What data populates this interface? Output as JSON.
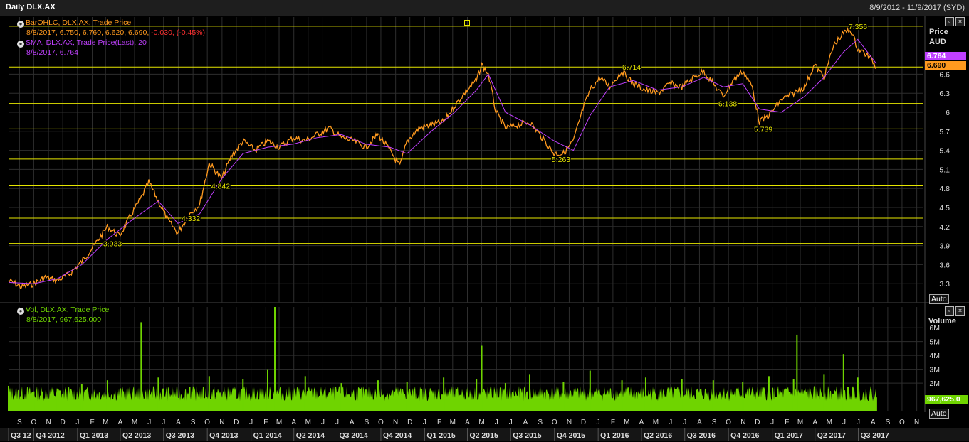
{
  "window": {
    "title": "Daily DLX.AX",
    "date_range": "8/9/2012 - 11/9/2017 (SYD)"
  },
  "price_panel": {
    "legend": {
      "bar_label": "BarOHLC, DLX.AX, Trade Price",
      "bar_values": "8/8/2017, 6.750, 6.760, 6.620, 6.690,",
      "bar_change": "-0.030, (-0.45%)",
      "sma_label": "SMA, DLX.AX, Trade Price(Last),  20",
      "sma_values": "8/8/2017, 6.764"
    },
    "axis_title_1": "Price",
    "axis_title_2": "AUD",
    "auto_label": "Auto",
    "last_sma_tag": "6.764",
    "last_price_tag": "6.690",
    "colors": {
      "price": "#ff9a1f",
      "sma": "#c040ff",
      "level": "#e6e600",
      "grid": "#2e2e2e"
    }
  },
  "volume_panel": {
    "legend": {
      "label": "Vol, DLX.AX, Trade Price",
      "values": "8/8/2017, 967,625.000"
    },
    "axis_title": "Volume",
    "auto_label": "Auto",
    "last_volume_tag": "967,625.0",
    "colors": {
      "volume": "#6fd400"
    }
  },
  "chart_data": [
    {
      "type": "line",
      "series": [
        {
          "name": "BarOHLC, DLX.AX, Trade Price",
          "x": [
            "2012-08-09",
            "2012-09-05",
            "2012-10-01",
            "2012-10-25",
            "2012-11-20",
            "2012-12-15",
            "2013-01-10",
            "2013-02-05",
            "2013-03-05",
            "2013-03-30",
            "2013-04-25",
            "2013-05-15",
            "2013-05-31",
            "2013-06-20",
            "2013-07-10",
            "2013-07-31",
            "2013-08-25",
            "2013-09-15",
            "2013-10-05",
            "2013-10-31",
            "2013-11-20",
            "2013-12-15",
            "2014-01-10",
            "2014-02-05",
            "2014-03-01",
            "2014-03-31",
            "2014-04-25",
            "2014-05-20",
            "2014-06-15",
            "2014-07-10",
            "2014-08-05",
            "2014-08-30",
            "2014-09-25",
            "2014-10-20",
            "2014-11-10",
            "2014-11-25",
            "2014-12-20",
            "2015-01-15",
            "2015-02-10",
            "2015-03-05",
            "2015-03-31",
            "2015-04-20",
            "2015-05-01",
            "2015-05-15",
            "2015-05-31",
            "2015-06-20",
            "2015-07-15",
            "2015-08-10",
            "2015-09-05",
            "2015-09-30",
            "2015-10-20",
            "2015-11-10",
            "2015-11-30",
            "2015-12-15",
            "2016-01-05",
            "2016-01-25",
            "2016-02-20",
            "2016-03-15",
            "2016-04-10",
            "2016-05-05",
            "2016-05-31",
            "2016-06-25",
            "2016-07-20",
            "2016-08-10",
            "2016-08-30",
            "2016-09-20",
            "2016-10-10",
            "2016-10-31",
            "2016-11-20",
            "2016-12-05",
            "2016-12-25",
            "2017-01-20",
            "2017-02-15",
            "2017-03-10",
            "2017-03-31",
            "2017-04-20",
            "2017-05-10",
            "2017-05-31",
            "2017-06-15",
            "2017-06-30",
            "2017-07-20",
            "2017-08-01",
            "2017-08-08"
          ],
          "y": [
            3.35,
            3.25,
            3.3,
            3.4,
            3.35,
            3.45,
            3.65,
            3.9,
            4.2,
            4.05,
            4.4,
            4.65,
            4.9,
            4.6,
            4.3,
            4.1,
            4.4,
            4.55,
            5.2,
            4.95,
            5.3,
            5.55,
            5.4,
            5.55,
            5.45,
            5.6,
            5.55,
            5.65,
            5.75,
            5.6,
            5.55,
            5.45,
            5.65,
            5.4,
            5.15,
            5.55,
            5.75,
            5.8,
            5.85,
            6.1,
            6.35,
            6.5,
            6.75,
            6.6,
            6.0,
            5.75,
            5.8,
            5.85,
            5.6,
            5.35,
            5.35,
            5.55,
            6.05,
            6.35,
            6.55,
            6.4,
            6.65,
            6.45,
            6.35,
            6.3,
            6.45,
            6.4,
            6.55,
            6.65,
            6.45,
            6.25,
            6.5,
            6.65,
            6.4,
            5.85,
            5.95,
            6.2,
            6.3,
            6.4,
            6.75,
            6.55,
            7.05,
            7.25,
            7.3,
            7.0,
            6.9,
            6.8,
            6.69
          ]
        },
        {
          "name": "SMA, DLX.AX, Trade Price(Last),  20",
          "x": [
            "2012-08-09",
            "2012-10-01",
            "2012-11-20",
            "2013-01-10",
            "2013-03-05",
            "2013-04-25",
            "2013-06-20",
            "2013-07-31",
            "2013-09-15",
            "2013-10-31",
            "2013-12-15",
            "2014-02-05",
            "2014-03-31",
            "2014-05-20",
            "2014-07-10",
            "2014-08-30",
            "2014-10-20",
            "2014-11-25",
            "2015-01-15",
            "2015-03-05",
            "2015-04-20",
            "2015-05-15",
            "2015-06-20",
            "2015-08-10",
            "2015-09-30",
            "2015-11-10",
            "2015-12-15",
            "2016-01-25",
            "2016-03-15",
            "2016-05-05",
            "2016-06-25",
            "2016-08-10",
            "2016-09-20",
            "2016-10-31",
            "2016-12-05",
            "2017-01-20",
            "2017-03-10",
            "2017-04-20",
            "2017-05-31",
            "2017-06-30",
            "2017-08-08"
          ],
          "y": [
            3.32,
            3.3,
            3.38,
            3.6,
            4.0,
            4.3,
            4.6,
            4.25,
            4.4,
            4.95,
            5.35,
            5.45,
            5.5,
            5.6,
            5.65,
            5.5,
            5.45,
            5.35,
            5.7,
            6.0,
            6.35,
            6.6,
            6.0,
            5.8,
            5.55,
            5.4,
            5.95,
            6.4,
            6.5,
            6.35,
            6.4,
            6.55,
            6.4,
            6.45,
            6.05,
            6.0,
            6.25,
            6.55,
            6.95,
            7.15,
            6.764
          ]
        }
      ],
      "ylim": [
        3.0,
        7.5
      ],
      "yticks": [
        "3.3",
        "3.6",
        "3.9",
        "4.2",
        "4.5",
        "4.8",
        "5.1",
        "5.4",
        "5.7",
        "6",
        "6.3",
        "6.6"
      ],
      "levels": [
        {
          "value": 7.356,
          "label": "7.356"
        },
        {
          "value": 6.714,
          "label": "6.714"
        },
        {
          "value": 6.138,
          "label": "6.138"
        },
        {
          "value": 5.739,
          "label": "5.739"
        },
        {
          "value": 5.263,
          "label": "5.263"
        },
        {
          "value": 4.842,
          "label": "4.842"
        },
        {
          "value": 4.332,
          "label": "4.332"
        },
        {
          "value": 3.933,
          "label": "3.933"
        }
      ],
      "grid": true
    },
    {
      "type": "bar",
      "series": [
        {
          "name": "Vol, DLX.AX, Trade Price",
          "x": [
            "2012-08-09",
            "2012-10-01",
            "2012-11-20",
            "2013-01-10",
            "2013-03-05",
            "2013-05-15",
            "2013-06-20",
            "2013-08-25",
            "2013-10-05",
            "2013-12-15",
            "2014-02-05",
            "2014-02-20",
            "2014-04-25",
            "2014-07-10",
            "2014-09-25",
            "2014-11-25",
            "2015-02-10",
            "2015-04-20",
            "2015-05-01",
            "2015-06-20",
            "2015-08-10",
            "2015-10-20",
            "2015-12-15",
            "2016-02-20",
            "2016-04-10",
            "2016-06-25",
            "2016-08-30",
            "2016-10-31",
            "2016-12-25",
            "2017-02-15",
            "2017-02-22",
            "2017-04-20",
            "2017-05-31",
            "2017-06-30",
            "2017-08-08"
          ],
          "y": [
            1800000,
            1400000,
            1600000,
            1900000,
            2200000,
            6400000,
            2400000,
            1700000,
            2500000,
            2300000,
            3000000,
            7500000,
            2500000,
            2000000,
            2200000,
            2100000,
            2400000,
            2300000,
            4700000,
            2000000,
            2600000,
            2100000,
            2900000,
            2200000,
            2400000,
            2300000,
            2200000,
            2100000,
            2500000,
            2300000,
            5500000,
            2600000,
            4100000,
            2400000,
            967625
          ]
        }
      ],
      "ylim": [
        0,
        7500000
      ],
      "yticks": [
        "2M",
        "3M",
        "4M",
        "5M",
        "6M"
      ],
      "grid": true
    }
  ],
  "x_axis": {
    "months": [
      "S",
      "O",
      "N",
      "D",
      "J",
      "F",
      "M",
      "A",
      "M",
      "J",
      "J",
      "A",
      "S",
      "O",
      "N",
      "D",
      "J",
      "F",
      "M",
      "A",
      "M",
      "J",
      "J",
      "A",
      "S",
      "O",
      "N",
      "D",
      "J",
      "F",
      "M",
      "A",
      "M",
      "J",
      "J",
      "A",
      "S",
      "O",
      "N",
      "D",
      "J",
      "F",
      "M",
      "A",
      "M",
      "J",
      "J",
      "A",
      "S",
      "O",
      "N",
      "D",
      "J",
      "F",
      "M",
      "A",
      "M",
      "J",
      "J",
      "A",
      "S",
      "O",
      "N"
    ],
    "quarters": [
      "Q3 12",
      "Q4 2012",
      "Q1 2013",
      "Q2 2013",
      "Q3 2013",
      "Q4 2013",
      "Q1 2014",
      "Q2 2014",
      "Q3 2014",
      "Q4 2014",
      "Q1 2015",
      "Q2 2015",
      "Q3 2015",
      "Q4 2015",
      "Q1 2016",
      "Q2 2016",
      "Q3 2016",
      "Q4 2016",
      "Q1 2017",
      "Q2 2017",
      "Q3 2017"
    ]
  }
}
